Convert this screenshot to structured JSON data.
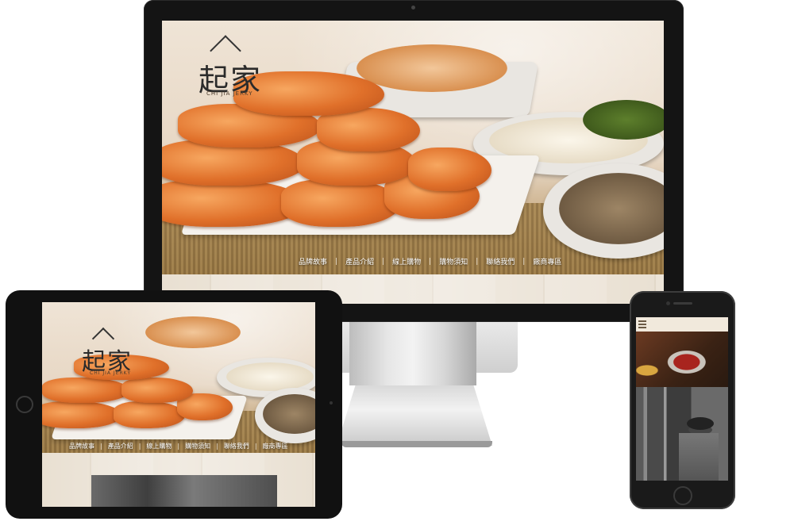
{
  "brand": {
    "name": "起家",
    "tagline": "CHI JIA JERKY"
  },
  "nav": {
    "items": [
      "品牌故事",
      "產品介紹",
      "線上購物",
      "購物須知",
      "聯絡我們",
      "廠商專區"
    ],
    "separator": "|"
  },
  "colors": {
    "nav_text": "#ffffff",
    "device_bezel": "#141414",
    "paper_background": "#e9e0d2",
    "jerky_orange": "#e0702a",
    "phone_topbar": "#f1e9dc"
  },
  "icons": {
    "menu": "hamburger-icon",
    "logo": "roof-icon"
  }
}
